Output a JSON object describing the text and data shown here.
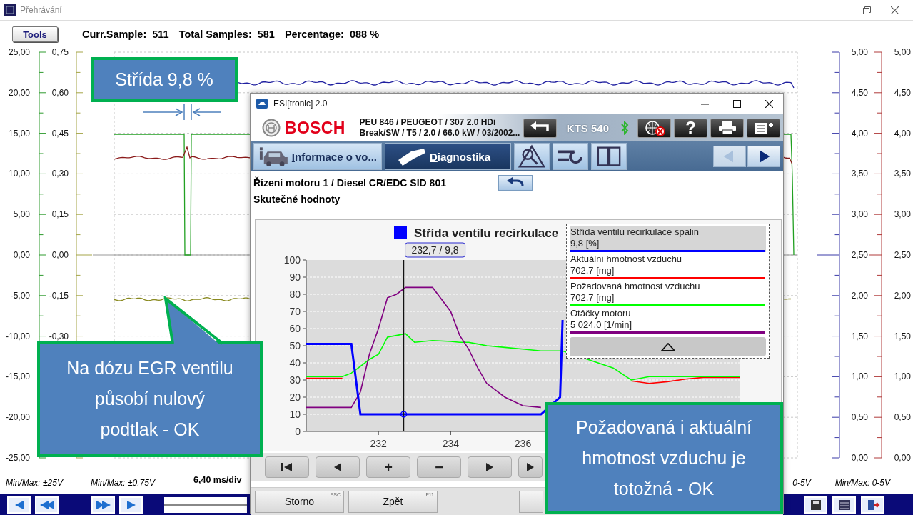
{
  "window": {
    "title": "Přehrávání"
  },
  "toolbar": {
    "tools_button": "Tools",
    "status": [
      {
        "label": "Curr.Sample:",
        "value": "511"
      },
      {
        "label": "Total Samples:",
        "value": "581"
      },
      {
        "label": "Percentage:",
        "value": "088 %"
      }
    ]
  },
  "scope": {
    "left_axes": [
      {
        "labels": [
          "25,00",
          "20,00",
          "15,00",
          "10,00",
          "5,00",
          "0,00",
          "-5,00",
          "-10,00",
          "-15,00",
          "-20,00",
          "-25,00"
        ]
      },
      {
        "labels": [
          "0,75",
          "0,60",
          "0,45",
          "0,30",
          "0,15",
          "0,00",
          "-0,15",
          "-0,30"
        ]
      }
    ],
    "right_axes": [
      {
        "labels": [
          "5,00",
          "4,50",
          "4,00",
          "3,50",
          "3,00",
          "2,50",
          "2,00",
          "1,50",
          "1,00",
          "0,50",
          "0,00"
        ]
      },
      {
        "labels": [
          "5,00",
          "4,50",
          "4,00",
          "3,50",
          "3,00",
          "2,50",
          "2,00",
          "1,50",
          "1,00",
          "0,50",
          "0,00"
        ]
      }
    ]
  },
  "bottom": {
    "left_ranges": [
      "Min/Max: ±25V",
      "Min/Max: ±0.75V"
    ],
    "timebase": "6,40 ms/div",
    "right_ranges": [
      "0-5V",
      "Min/Max: 0-5V"
    ]
  },
  "esi": {
    "title": "ESI[tronic] 2.0",
    "brand": "BOSCH",
    "vehicle": [
      "PEU 846 / PEUGEOT / 307 2.0 HDi",
      "Break/SW / T5 / 2.0 / 66.0 kW / 03/2002..."
    ],
    "device": "KTS 540",
    "help_label": "?",
    "tabs": [
      {
        "label": "Informace o vo...",
        "kind": "info",
        "selected": false
      },
      {
        "label": "Diagnostika",
        "kind": "diag",
        "selected": true
      }
    ],
    "nav": [
      {
        "kind": "prev",
        "disabled": true
      },
      {
        "kind": "next",
        "disabled": false
      }
    ],
    "breadcrumb": "Řízení motoru 1 / Diesel CR/EDC SID 801",
    "section": "Skutečné hodnoty",
    "chart_data": {
      "type": "line",
      "title": "Střída ventilu recirkulace",
      "grid": true,
      "x": [
        230,
        230.5,
        231,
        231.25,
        231.5,
        231.75,
        232,
        232.25,
        232.5,
        232.75,
        233,
        233.5,
        234,
        234.25,
        234.5,
        234.75,
        235,
        235.5,
        236,
        236.5,
        237.03,
        237.1,
        238.5,
        239,
        239.5,
        240,
        240.5,
        241,
        241.5,
        242
      ],
      "series": [
        {
          "name": "Střída ventilu recirkulace spalin",
          "color": "#0000ff",
          "values": [
            51,
            51,
            51,
            51,
            10,
            10,
            10,
            10,
            10,
            10,
            10,
            10,
            10,
            10,
            10,
            10,
            10,
            10,
            10,
            10,
            20,
            65,
            null,
            null,
            null,
            null,
            null,
            null,
            null,
            null
          ]
        },
        {
          "name": "Aktuální hmotnost vzduchu",
          "color": "#ff0000",
          "values": [
            31,
            31,
            31,
            null,
            null,
            null,
            null,
            null,
            null,
            null,
            null,
            null,
            null,
            null,
            null,
            null,
            null,
            null,
            null,
            null,
            null,
            null,
            null,
            29.5,
            28,
            29,
            30.5,
            31.5,
            31.5,
            31.5
          ]
        },
        {
          "name": "Požadovaná hmotnost vzduchu",
          "color": "#00ff00",
          "values": [
            32,
            32,
            32,
            34,
            38,
            42,
            45,
            55,
            56,
            57,
            52,
            53,
            52.5,
            52,
            52,
            51,
            50,
            49,
            48,
            47,
            47,
            47,
            37,
            30,
            32,
            32,
            32,
            32,
            32,
            32
          ]
        },
        {
          "name": "Otáčky motoru",
          "color": "#800080",
          "values": [
            14,
            14,
            14,
            14,
            23,
            45,
            60,
            78,
            80,
            84,
            84,
            84,
            70,
            56,
            48,
            37,
            28,
            20,
            15,
            14,
            null,
            null,
            null,
            null,
            null,
            null,
            null,
            null,
            null,
            null
          ]
        }
      ],
      "xlim": [
        230,
        242
      ],
      "ylim": [
        0,
        100
      ],
      "xticks": [
        232,
        234,
        236
      ],
      "yticks": [
        0,
        10,
        20,
        30,
        40,
        50,
        60,
        70,
        80,
        90,
        100
      ],
      "ref_lines": [
        {
          "axis": "x",
          "value": 232.7,
          "color": "#111111"
        }
      ],
      "annotations": [
        "232,7 / 9,8"
      ]
    },
    "legend": [
      {
        "value": "9,8 [%]",
        "selected": true
      },
      {
        "value": "702,7 [mg]",
        "selected": false
      },
      {
        "value": "702,7 [mg]",
        "selected": false
      },
      {
        "value": "5 024,0 [1/min]",
        "selected": false
      }
    ],
    "chart_buttons": [
      {
        "kind": "first"
      },
      {
        "kind": "prev"
      },
      {
        "kind": "text",
        "label": "+"
      },
      {
        "kind": "text",
        "label": "−"
      },
      {
        "kind": "next"
      },
      {
        "kind": "next"
      }
    ],
    "footer_buttons": [
      {
        "kind": "labeled",
        "label": "Storno",
        "hint": "ESC"
      },
      {
        "kind": "labeled",
        "label": "Zpět",
        "hint": "F11"
      },
      {
        "kind": "blank"
      }
    ]
  },
  "callouts": [
    {
      "text": "Střída 9,8 %",
      "kind": "arrows"
    },
    {
      "text": "Na dózu EGR ventilu\npůsobí nulový\npodtlak - OK",
      "kind": "pointer"
    },
    {
      "text": "Požadovaná i aktuální hmotnost vzduchu je totožná - OK",
      "kind": "plain"
    }
  ]
}
